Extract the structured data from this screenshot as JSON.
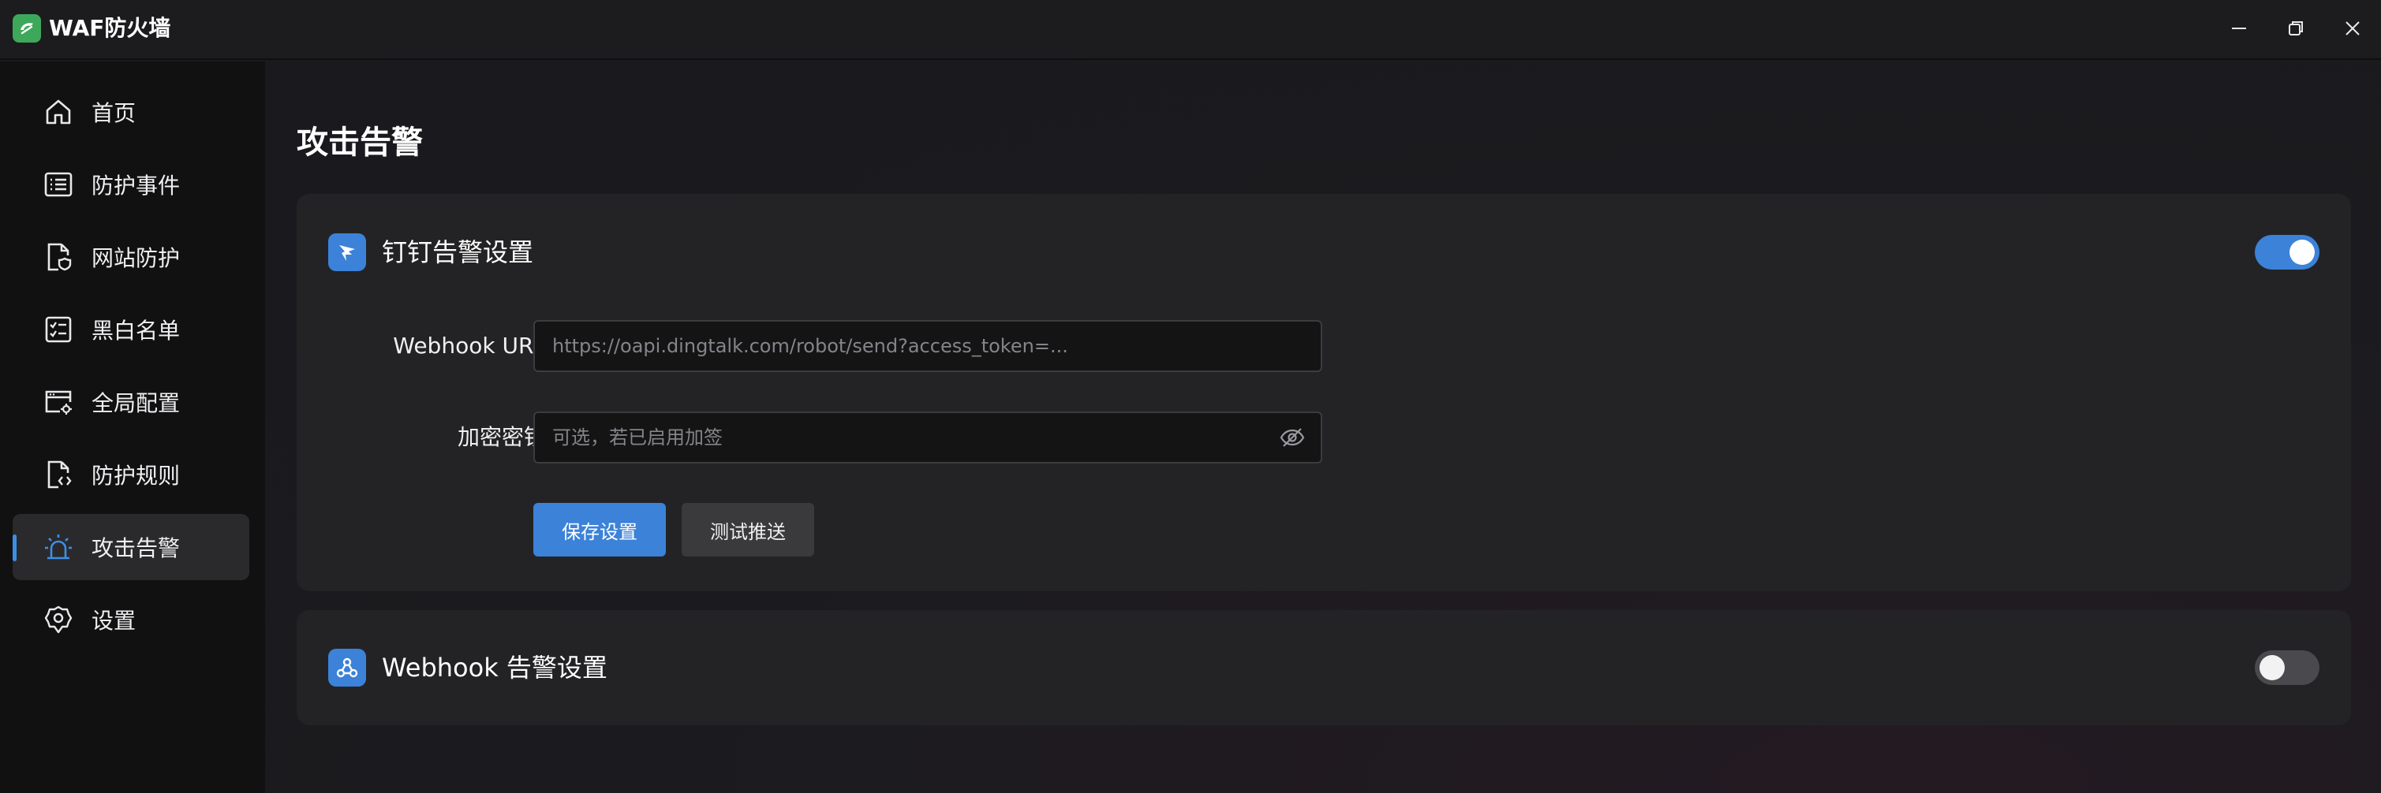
{
  "app": {
    "title": "WAF防火墙"
  },
  "sidebar": {
    "items": [
      {
        "label": "首页",
        "icon": "home-icon"
      },
      {
        "label": "防护事件",
        "icon": "list-icon"
      },
      {
        "label": "网站防护",
        "icon": "site-shield-icon"
      },
      {
        "label": "黑白名单",
        "icon": "checklist-icon"
      },
      {
        "label": "全局配置",
        "icon": "config-icon"
      },
      {
        "label": "防护规则",
        "icon": "rule-file-icon"
      },
      {
        "label": "攻击告警",
        "icon": "alarm-icon",
        "active": true
      },
      {
        "label": "设置",
        "icon": "gear-icon"
      }
    ]
  },
  "main": {
    "page_title": "攻击告警",
    "dingtalk": {
      "title": "钉钉告警设置",
      "enabled": true,
      "webhook_label": "Webhook URL",
      "webhook_placeholder": "https://oapi.dingtalk.com/robot/send?access_token=...",
      "webhook_value": "",
      "secret_label": "加密密钥",
      "secret_placeholder": "可选，若已启用加签",
      "secret_value": "",
      "save_label": "保存设置",
      "test_label": "测试推送"
    },
    "webhook": {
      "title": "Webhook 告警设置",
      "enabled": false
    }
  },
  "colors": {
    "accent": "#3b82d8",
    "logo_green": "#3ea85a",
    "sidebar_bg": "#111112",
    "card_bg": "#232325"
  }
}
